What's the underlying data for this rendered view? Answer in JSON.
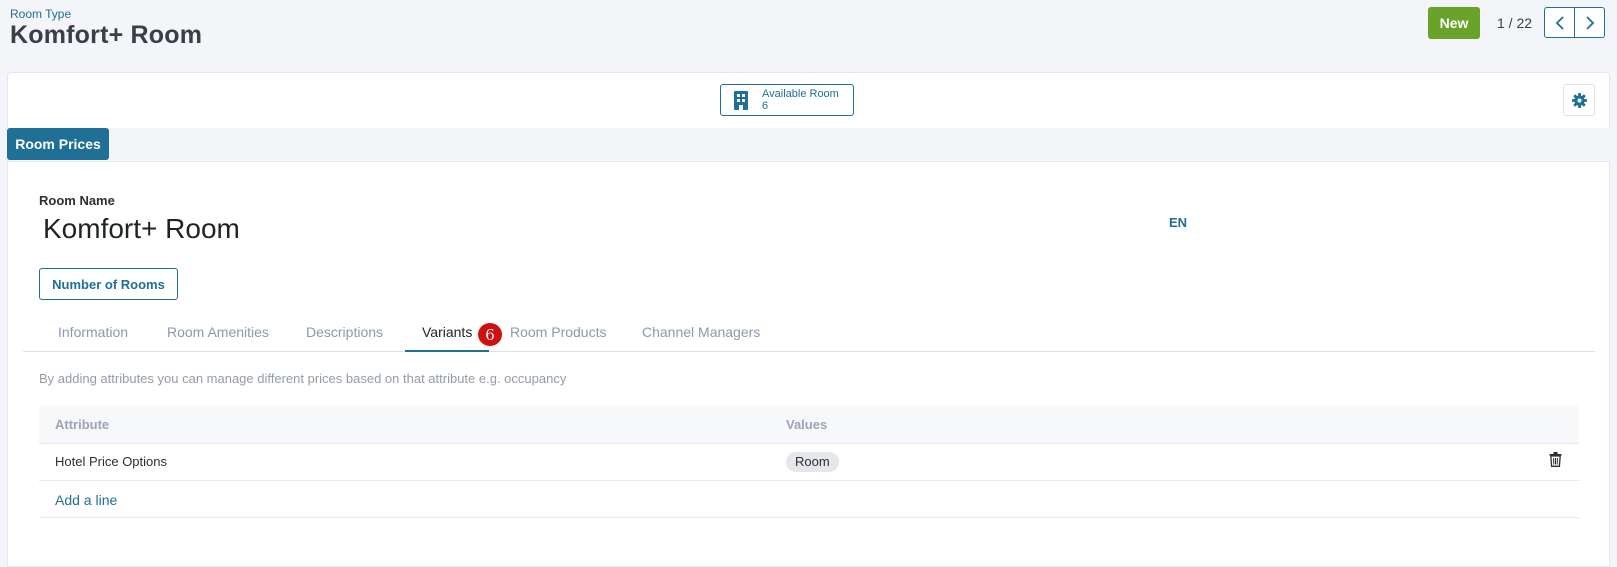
{
  "breadcrumb": {
    "parent": "Room Type",
    "current": "Komfort+ Room"
  },
  "toolbar": {
    "new_label": "New"
  },
  "pager": {
    "value": "1 / 22"
  },
  "smart_button": {
    "label": "Available Room",
    "value": "6",
    "icon": "building-icon"
  },
  "room_prices_label": "Room Prices",
  "form": {
    "name_label": "Room Name",
    "name_value": "Komfort+ Room",
    "lang": "EN",
    "rooms_button": "Number of Rooms"
  },
  "tabs": [
    {
      "label": "Information",
      "active": false
    },
    {
      "label": "Room Amenities",
      "active": false
    },
    {
      "label": "Descriptions",
      "active": false
    },
    {
      "label": "Variants",
      "active": true
    },
    {
      "label": "Room Products",
      "active": false
    },
    {
      "label": "Channel Managers",
      "active": false
    }
  ],
  "variants_badge": "6",
  "variants": {
    "help_text": "By adding attributes you can manage different prices based on that attribute e.g. occupancy",
    "columns": [
      "Attribute",
      "Values"
    ],
    "rows": [
      {
        "attribute": "Hotel Price Options",
        "values": [
          "Room"
        ]
      }
    ],
    "add_line": "Add a line"
  },
  "colors": {
    "primary": "#1f6f96",
    "success": "#6aa329",
    "badge": "#d00f0f"
  }
}
